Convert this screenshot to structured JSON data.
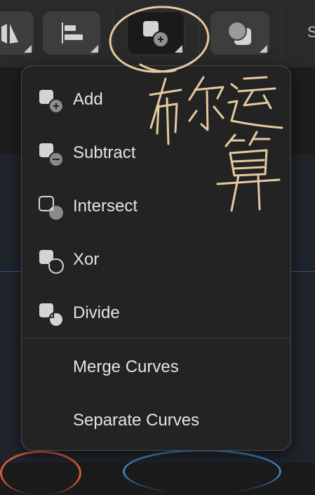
{
  "toolbar": {
    "buttons": [
      {
        "name": "mirror",
        "icon": "mirror-icon"
      },
      {
        "name": "align",
        "icon": "align-left-icon"
      },
      {
        "name": "boolean-operations",
        "icon": "boolean-add-icon",
        "active": true
      },
      {
        "name": "mask",
        "icon": "mask-icon"
      }
    ],
    "cut_label": "S"
  },
  "menu": {
    "items": [
      {
        "label": "Add",
        "icon": "boolean-add-icon"
      },
      {
        "label": "Subtract",
        "icon": "boolean-subtract-icon"
      },
      {
        "label": "Intersect",
        "icon": "boolean-intersect-icon"
      },
      {
        "label": "Xor",
        "icon": "boolean-xor-icon"
      },
      {
        "label": "Divide",
        "icon": "boolean-divide-icon"
      },
      {
        "label": "Merge Curves"
      },
      {
        "label": "Separate Curves"
      }
    ]
  },
  "annotation": {
    "text": "布尔运算",
    "color": "#e6c9a0"
  },
  "colors": {
    "toolbar_bg": "#2a2a2a",
    "button_bg": "#3d3d3d",
    "menu_bg": "#232323",
    "menu_text": "#e3e3e3",
    "icon_light": "#d4d4d4",
    "icon_dark": "#8a8a8a"
  }
}
